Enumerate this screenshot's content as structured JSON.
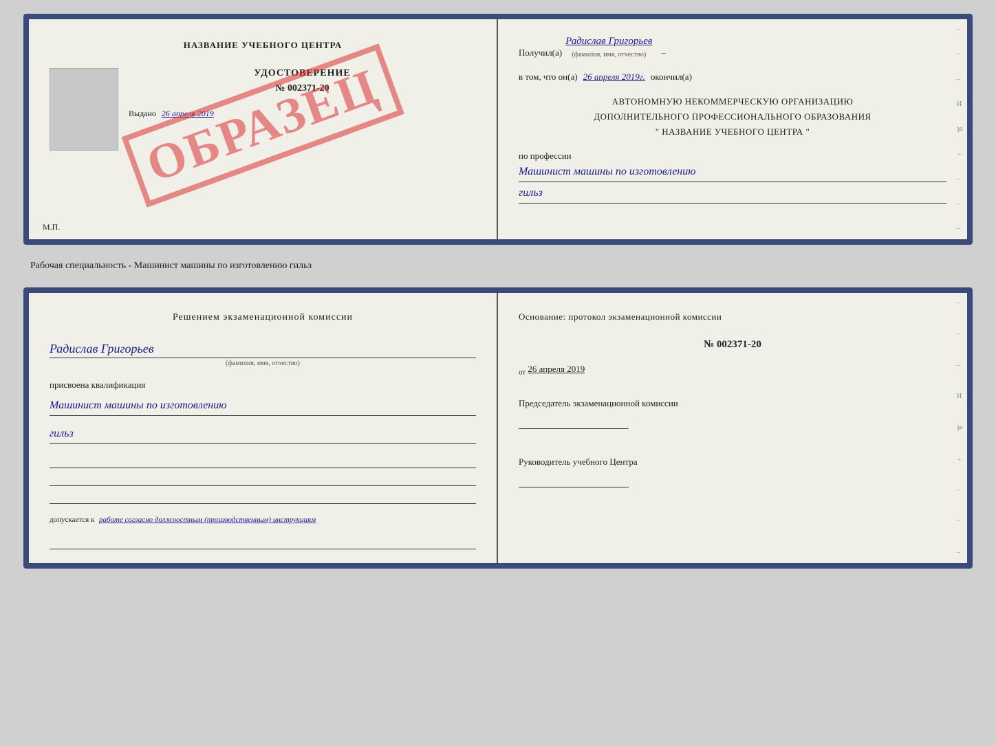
{
  "top_document": {
    "left": {
      "school_name": "НАЗВАНИЕ УЧЕБНОГО ЦЕНТРА",
      "watermark": "ОБРАЗЕЦ",
      "cert_title": "УДОСТОВЕРЕНИЕ",
      "cert_number": "№ 002371-20",
      "issued_label": "Выдано",
      "issued_date": "26 апреля 2019",
      "mp_label": "М.П."
    },
    "right": {
      "recipient_prefix": "Получил(а)",
      "recipient_name": "Радислав Григорьев",
      "recipient_sub": "(фамилия, имя, отчество)",
      "dash": "–",
      "date_prefix": "в том, что он(а)",
      "date_value": "26 апреля 2019г.",
      "date_suffix": "окончил(а)",
      "org_line1": "АВТОНОМНУЮ НЕКОММЕРЧЕСКУЮ ОРГАНИЗАЦИЮ",
      "org_line2": "ДОПОЛНИТЕЛЬНОГО ПРОФЕССИОНАЛЬНОГО ОБРАЗОВАНИЯ",
      "org_line3": "\" НАЗВАНИЕ УЧЕБНОГО ЦЕНТРА \"",
      "profession_prefix": "по профессии",
      "profession_handwritten": "Машинист машины по изготовлению",
      "profession_handwritten2": "гильз"
    }
  },
  "specialty_label": "Рабочая специальность - Машинист машины по изготовлению гильз",
  "bottom_document": {
    "left": {
      "commission_title": "Решением экзаменационной комиссии",
      "name_handwritten": "Радислав Григорьев",
      "name_sub": "(фамилия, имя, отчество)",
      "qualification_label": "присвоена квалификация",
      "qualification_handwritten": "Машинист машины по изготовлению",
      "qualification_handwritten2": "гильз",
      "допускается_prefix": "допускается к",
      "допускается_text": "работе согласно должностным (производственным) инструкциям"
    },
    "right": {
      "osnov_title": "Основание: протокол экзаменационной комиссии",
      "protocol_number": "№ 002371-20",
      "protocol_date_prefix": "от",
      "protocol_date": "26 апреля 2019",
      "chairman_title": "Председатель экзаменационной комиссии",
      "director_title": "Руководитель учебного Центра"
    }
  },
  "side_dashes": [
    "–",
    "–",
    "–",
    "И",
    "ҙа",
    "←",
    "–",
    "–",
    "–"
  ]
}
